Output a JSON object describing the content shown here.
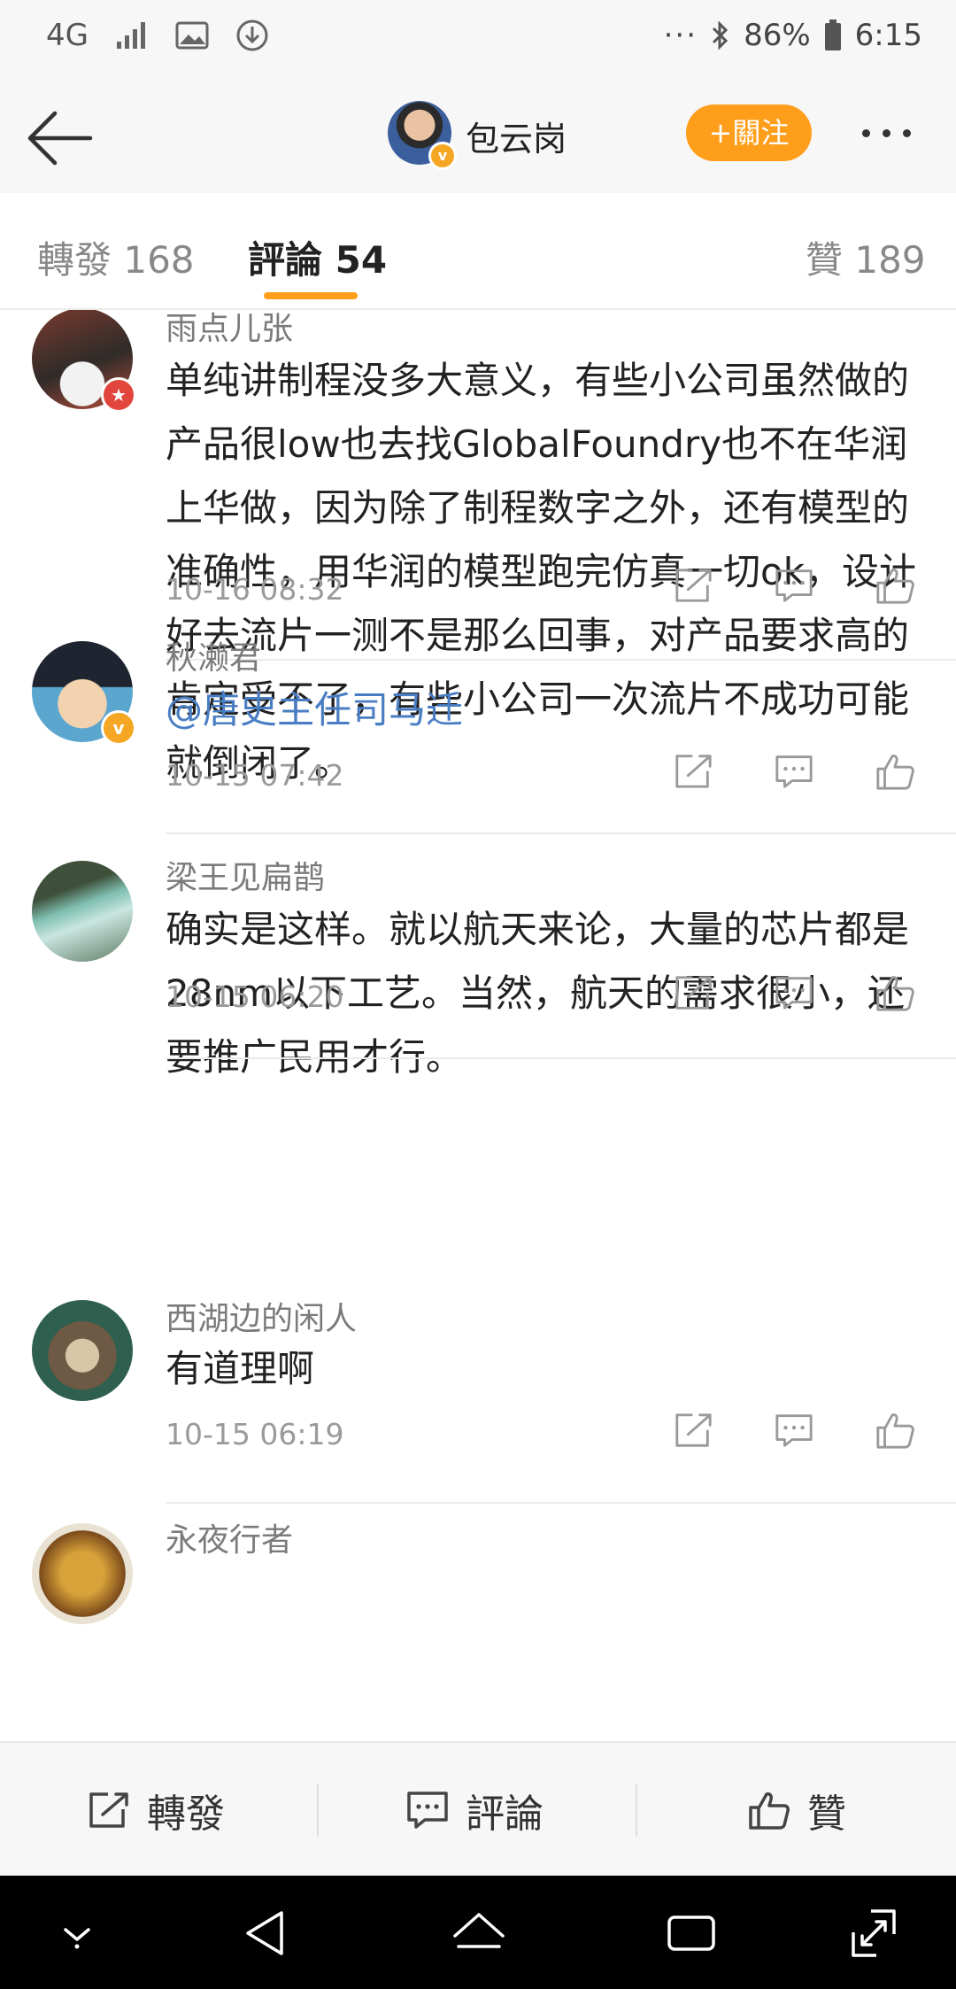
{
  "status_bar": {
    "network": "4G",
    "battery": "86%",
    "time": "6:15",
    "more": "···"
  },
  "header": {
    "username": "包云岗",
    "follow_label": "+關注",
    "verified_mark": "v"
  },
  "tabs": {
    "repost": "轉發 168",
    "comments": "評論 54",
    "likes": "贊 189"
  },
  "comments": [
    {
      "name": "雨点儿张",
      "text": "单纯讲制程没多大意义，有些小公司虽然做的产品很low也去找GlobalFoundry也不在华润上华做，因为除了制程数字之外，还有模型的准确性，用华润的模型跑完仿真一切ok，设计好去流片一测不是那么回事，对产品要求高的肯定受不了，有些小公司一次流片不成功可能就倒闭了。",
      "time": "10-16 08:32",
      "badge_color": "#e2453b"
    },
    {
      "name": "秋濑君",
      "text": "@唐史主任司马迁",
      "time": "10-15 07:42",
      "badge_color": "#f5a623"
    },
    {
      "name": "梁王见扁鹊",
      "text": "确实是这样。就以航天来论，大量的芯片都是28nm以下工艺。当然，航天的需求很小，还要推广民用才行。",
      "time": "10-15 06:20"
    },
    {
      "name": "西湖边的闲人",
      "text": "有道理啊",
      "time": "10-15 06:19"
    },
    {
      "name": "永夜行者"
    }
  ],
  "bottom_bar": {
    "repost": "轉發",
    "comment": "評論",
    "like": "贊"
  },
  "colors": {
    "accent": "#ff9e1b",
    "mention": "#4a7ec4"
  }
}
